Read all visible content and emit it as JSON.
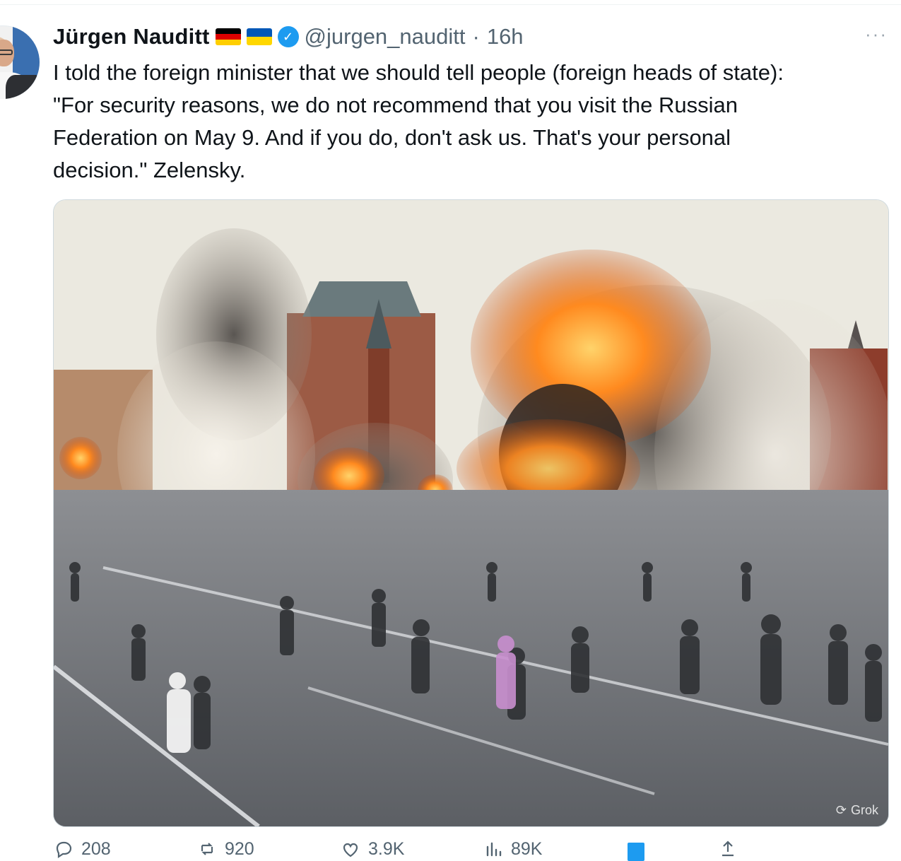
{
  "author": {
    "name": "Jürgen Nauditt",
    "flags": [
      "germany-flag",
      "ukraine-flag"
    ],
    "verified": true,
    "handle": "@jurgen_nauditt",
    "time": "16h",
    "separator": "·"
  },
  "tweet": {
    "text": "I told the foreign minister that we should tell people (foreign heads of state):\n\"For security reasons, we do not recommend that you visit the Russian\nFederation on May 9. And if you do, don't ask us. That's your personal\ndecision.\" Zelensky."
  },
  "media": {
    "watermark": "Grok",
    "watermark_icon": "grok-icon"
  },
  "actions": {
    "reply_count": "208",
    "retweet_count": "920",
    "like_count": "3.9K",
    "views_count": "89K"
  },
  "icons": {
    "more": "more-icon",
    "reply": "reply-icon",
    "retweet": "retweet-icon",
    "like": "heart-icon",
    "views": "views-icon",
    "bookmark": "bookmark-icon",
    "share": "share-icon"
  },
  "colors": {
    "accent": "#1d9bf0",
    "text": "#0f1419",
    "muted": "#536471"
  }
}
